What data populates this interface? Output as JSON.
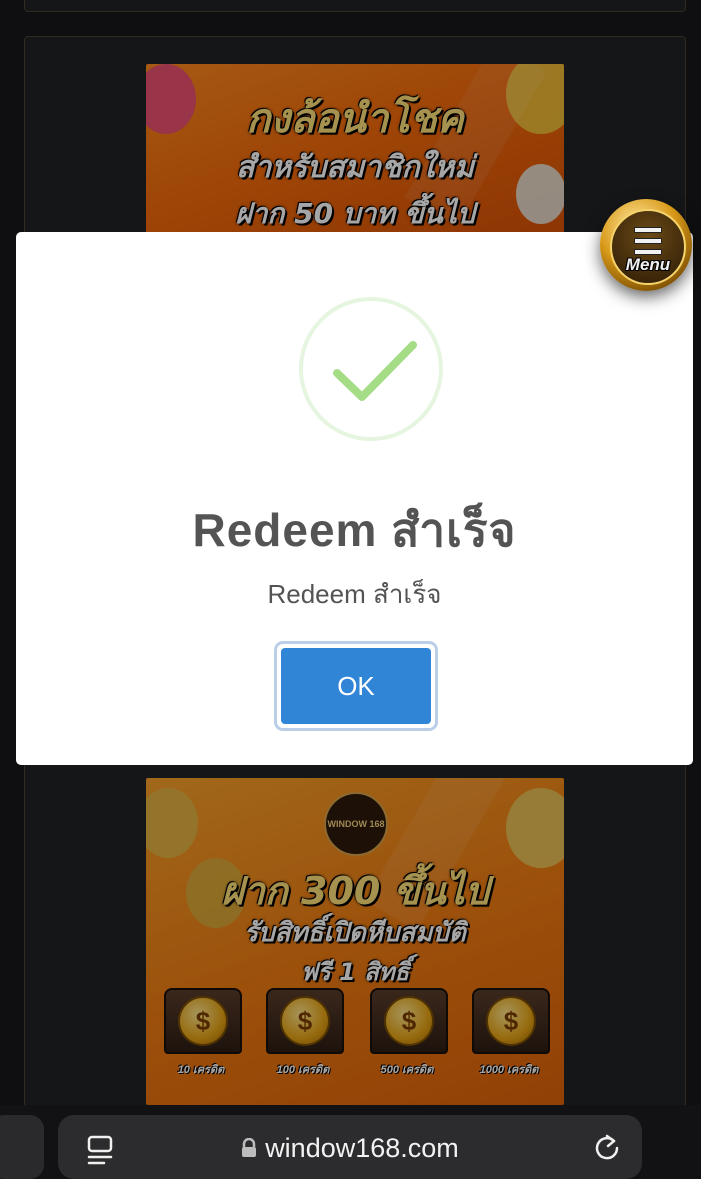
{
  "background": {
    "banner_top": {
      "line1": "กงล้อนำโชค",
      "line2": "สำหรับสมาชิกใหม่",
      "line3": "ฝาก 50 บาท ขึ้นไป"
    },
    "banner_bottom": {
      "logo": "WINDOW 168",
      "line1": "ฝาก 300 ขึ้นไป",
      "line2": "รับสิทธิ์เปิดหีบสมบัติ",
      "line3": "ฟรี 1 สิทธิ์",
      "chests": [
        {
          "label": "10 เครดิต",
          "icon": "dollar-coin"
        },
        {
          "label": "100 เครดิต",
          "icon": "dollar-coin"
        },
        {
          "label": "500 เครดิต",
          "icon": "dollar-coin"
        },
        {
          "label": "1000 เครดิต",
          "icon": "dollar-coin"
        }
      ]
    }
  },
  "menu": {
    "label": "Menu",
    "icon": "hamburger-icon"
  },
  "modal": {
    "icon": "success-check-icon",
    "title": "Redeem สำเร็จ",
    "text": "Redeem สำเร็จ",
    "ok_label": "OK",
    "accent": "#3085d6",
    "success_color": "#a5dc86"
  },
  "browser": {
    "url": "window168.com",
    "icons": [
      "tabs-icon",
      "lock-icon",
      "reload-icon"
    ]
  }
}
